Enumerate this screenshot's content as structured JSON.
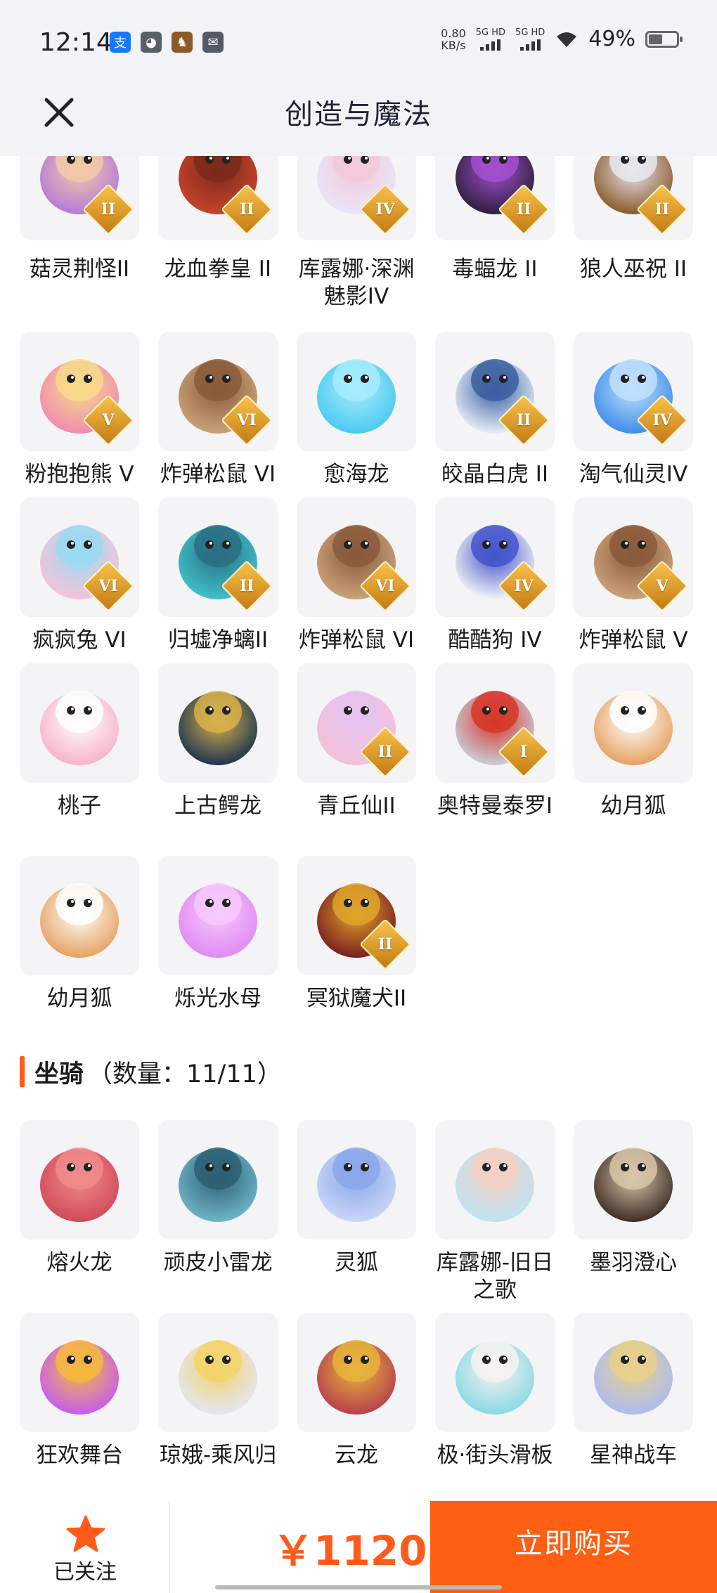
{
  "status_bar": {
    "time": "12:14",
    "net_speed_value": "0.80",
    "net_speed_unit": "KB/s",
    "sim1": "5G HD",
    "sim2": "5G HD",
    "battery": "49%",
    "battery_level": 0.49,
    "app_icons": [
      "alipay-icon",
      "cat-icon",
      "game-icon",
      "message-icon"
    ]
  },
  "header": {
    "title": "创造与魔法",
    "close_icon": "close-icon"
  },
  "pets": [
    {
      "name": "菇灵荆怪II",
      "rank": "II",
      "art": "purple-mushroom-sprite"
    },
    {
      "name": "龙血拳皇 II",
      "rank": "II",
      "art": "red-ram-beast"
    },
    {
      "name": "库露娜·深渊魅影IV",
      "rank": "IV",
      "art": "white-haired-girl"
    },
    {
      "name": "毒蝠龙 II",
      "rank": "II",
      "art": "black-purple-dragon"
    },
    {
      "name": "狼人巫祝 II",
      "rank": "II",
      "art": "masked-werewolf"
    },
    {
      "name": "粉抱抱熊 V",
      "rank": "V",
      "art": "pink-bear"
    },
    {
      "name": "炸弹松鼠 VI",
      "rank": "VI",
      "art": "bomb-squirrel"
    },
    {
      "name": "愈海龙",
      "rank": "",
      "art": "cyan-sea-dragon"
    },
    {
      "name": "皎晶白虎 II",
      "rank": "II",
      "art": "white-crystal-tiger"
    },
    {
      "name": "淘气仙灵IV",
      "rank": "IV",
      "art": "blue-puppy-spirit"
    },
    {
      "name": "疯疯兔 VI",
      "rank": "VI",
      "art": "crazy-rabbit"
    },
    {
      "name": "归墟净螭II",
      "rank": "II",
      "art": "teal-dragon"
    },
    {
      "name": "炸弹松鼠 VI",
      "rank": "VI",
      "art": "bomb-squirrel"
    },
    {
      "name": "酷酷狗 IV",
      "rank": "IV",
      "art": "goggles-dog"
    },
    {
      "name": "炸弹松鼠 V",
      "rank": "V",
      "art": "bomb-squirrel"
    },
    {
      "name": "桃子",
      "rank": "",
      "art": "pink-kitten"
    },
    {
      "name": "上古鳄龙",
      "rank": "",
      "art": "ancient-croc-dragon"
    },
    {
      "name": "青丘仙II",
      "rank": "II",
      "art": "fox-fairy"
    },
    {
      "name": "奥特曼泰罗I",
      "rank": "I",
      "art": "ultraman-taro"
    },
    {
      "name": "幼月狐",
      "rank": "",
      "art": "young-moon-fox"
    },
    {
      "name": "幼月狐",
      "rank": "",
      "art": "young-moon-fox"
    },
    {
      "name": "烁光水母",
      "rank": "",
      "art": "pink-jellyfish"
    },
    {
      "name": "冥狱魔犬II",
      "rank": "II",
      "art": "hell-hound"
    }
  ],
  "mounts_section": {
    "title": "坐骑",
    "count_text": "（数量：11/11）"
  },
  "mounts": [
    {
      "name": "熔火龙",
      "art": "lava-dragon"
    },
    {
      "name": "顽皮小雷龙",
      "art": "naughty-thunder-dragon"
    },
    {
      "name": "灵狐",
      "art": "spirit-fox"
    },
    {
      "name": "库露娜-旧日之歌",
      "art": "kuluna-song"
    },
    {
      "name": "墨羽澄心",
      "art": "ink-feather-staff"
    },
    {
      "name": "狂欢舞台",
      "art": "carnival-stage"
    },
    {
      "name": "琼娥-乘风归",
      "art": "moon-fairy"
    },
    {
      "name": "云龙",
      "art": "cloud-dragon"
    },
    {
      "name": "极·街头滑板",
      "art": "street-skateboard"
    },
    {
      "name": "星神战车",
      "art": "star-chariot"
    }
  ],
  "bottom_bar": {
    "follow_label": "已关注",
    "follow_icon": "star-icon",
    "price": "￥1120",
    "buy_label": "立即购买"
  },
  "colors": {
    "accent": "#ff5f12",
    "price": "#ff5b1a",
    "header_bg": "#f1f3f7",
    "card_bg": "#f4f4f6",
    "rank_badge": "#e09a25"
  }
}
